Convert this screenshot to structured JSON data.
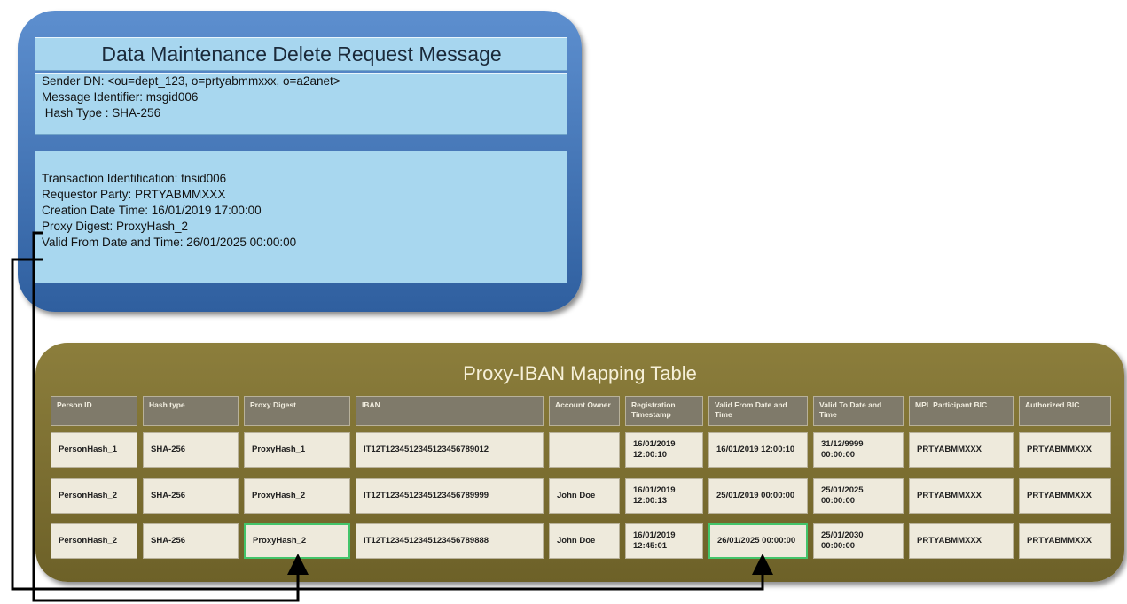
{
  "message": {
    "title": "Data Maintenance Delete Request Message",
    "header_lines": [
      "Sender DN: <ou=dept_123, o=prtyabmmxxx, o=a2anet>",
      "Message Identifier: msgid006",
      " Hash Type : SHA-256"
    ],
    "body_lines": [
      "Transaction Identification: tnsid006",
      "Requestor Party: PRTYABMMXXX",
      "Creation Date Time: 16/01/2019 17:00:00",
      "Proxy Digest: ProxyHash_2",
      "Valid From Date and Time: 26/01/2025 00:00:00"
    ]
  },
  "table": {
    "title": "Proxy-IBAN Mapping Table",
    "columns": [
      "Person ID",
      "Hash type",
      "Proxy Digest",
      "IBAN",
      "Account Owner",
      "Registration Timestamp",
      "Valid From Date and Time",
      "Valid To Date and Time",
      "MPL Participant BIC",
      "Authorized BIC"
    ],
    "rows": [
      [
        "PersonHash_1",
        "SHA-256",
        "ProxyHash_1",
        "IT12T1234512345123456789012",
        "",
        "16/01/2019 12:00:10",
        "16/01/2019 12:00:10",
        "31/12/9999 00:00:00",
        "PRTYABMMXXX",
        "PRTYABMMXXX"
      ],
      [
        "PersonHash_2",
        "SHA-256",
        "ProxyHash_2",
        "IT12T1234512345123456789999",
        "John Doe",
        "16/01/2019 12:00:13",
        "25/01/2019 00:00:00",
        "25/01/2025 00:00:00",
        "PRTYABMMXXX",
        "PRTYABMMXXX"
      ],
      [
        "PersonHash_2",
        "SHA-256",
        "ProxyHash_2",
        "IT12T1234512345123456789888",
        "John Doe",
        "16/01/2019 12:45:01",
        "26/01/2025 00:00:00",
        "25/01/2030 00:00:00",
        "PRTYABMMXXX",
        "PRTYABMMXXX"
      ]
    ],
    "highlighted_cells": [
      [
        2,
        2
      ],
      [
        2,
        6
      ]
    ]
  },
  "colors": {
    "message_fill": "#3f72b6",
    "message_band": "#a8d7ef",
    "table_fill": "#7d7032",
    "header_cell": "#7f7a6a",
    "data_cell": "#eeeadc",
    "highlight": "#43c46a"
  }
}
